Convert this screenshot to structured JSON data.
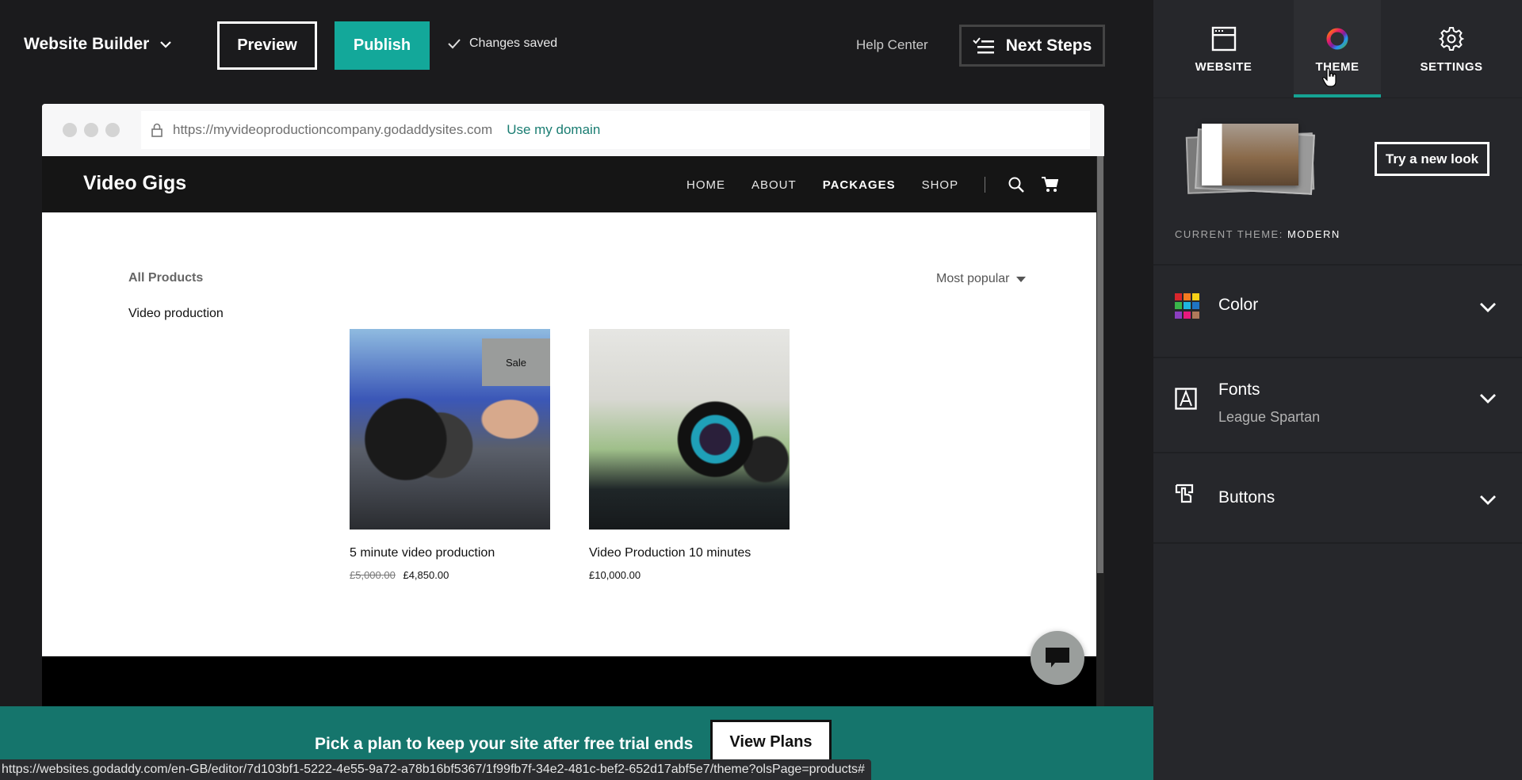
{
  "topbar": {
    "brand": "Website Builder",
    "preview": "Preview",
    "publish": "Publish",
    "saved_status": "Changes saved",
    "help": "Help Center",
    "next_steps": "Next Steps",
    "accent": "#13a89a"
  },
  "browser": {
    "url": "https://myvideoproductioncompany.godaddysites.com",
    "domain_link": "Use my domain"
  },
  "site": {
    "logo": "Video Gigs",
    "nav": [
      "HOME",
      "ABOUT",
      "PACKAGES",
      "SHOP"
    ],
    "active_nav": "PACKAGES",
    "all_products": "All Products",
    "category": "Video production",
    "sort": "Most popular",
    "products": [
      {
        "title": "5 minute video production",
        "badge": "Sale",
        "old_price": "£5,000.00",
        "price": "£4,850.00"
      },
      {
        "title": "Video Production 10 minutes",
        "price": "£10,000.00"
      }
    ]
  },
  "banner": {
    "text": "Pick a plan to keep your site after free trial ends",
    "button": "View Plans",
    "color": "#15756c"
  },
  "status_url": "https://websites.godaddy.com/en-GB/editor/7d103bf1-5222-4e55-9a72-a78b16bf5367/1f99fb7f-34e2-481c-bef2-652d17abf5e7/theme?olsPage=products#",
  "panel": {
    "tabs": [
      {
        "label": "WEBSITE",
        "icon": "browser-window-icon"
      },
      {
        "label": "THEME",
        "icon": "color-ring-icon",
        "active": true
      },
      {
        "label": "SETTINGS",
        "icon": "gear-icon"
      }
    ],
    "try_new_look": "Try a new look",
    "current_theme_label": "CURRENT THEME:",
    "current_theme": "MODERN",
    "sections": [
      {
        "title": "Color",
        "icon": "color-palette-icon",
        "swatches": [
          "#d8262c",
          "#f47b20",
          "#f7d117",
          "#3ab54a",
          "#1fb5e0",
          "#1f74c2",
          "#8b3fbf",
          "#e8197d",
          "#b0795a"
        ]
      },
      {
        "title": "Fonts",
        "subtitle": "League Spartan",
        "icon": "font-icon"
      },
      {
        "title": "Buttons",
        "icon": "button-touch-icon"
      }
    ],
    "active_color": "#16a394"
  }
}
